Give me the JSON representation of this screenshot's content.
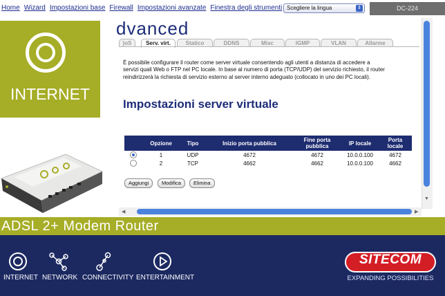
{
  "nav": {
    "items": [
      "Home",
      "Wizard",
      "Impostazioni base",
      "Firewall",
      "Impostazioni avanzate",
      "Finestra degli strumenti"
    ],
    "language_select": "Scegliere la lingua",
    "model": "DC-224"
  },
  "left_panel": {
    "big_label": "INTERNET"
  },
  "page": {
    "title": "dvanced",
    "tabs": [
      "QoS",
      "Serv. virt.",
      "Statico",
      "DDNS",
      "Misc",
      "IGMP",
      "VLAN",
      "Allarme"
    ],
    "tab_labels_visible": [
      ")oS",
      "Serv. virt.",
      "Statico",
      "DDNS",
      "Misc",
      "IGMP",
      "VLAN",
      "Allarme"
    ],
    "active_tab": "Serv. virt.",
    "description": "È possibile configurare il router come server virtuale consentendo agli utenti a distanza di accedere a servizi quali Web o FTP nel PC locale. In base al numero di porta (TCP/UDP) del servizio richiesto, il router reindirizzerà la richiesta di servizio esterno al server interno adeguato (collocato in uno dei PC locali).",
    "section_title": "Impostazioni server virtuale",
    "table": {
      "headers": [
        "",
        "Opzione",
        "Tipo",
        "Inizio porta pubblica",
        "Fine porta pubblica",
        "IP locale",
        "Porta locale"
      ],
      "rows": [
        {
          "selected": true,
          "opzione": "1",
          "tipo": "UDP",
          "inizio": "4672",
          "fine": "4672",
          "ip": "10.0.0.100",
          "porta": "4672"
        },
        {
          "selected": false,
          "opzione": "2",
          "tipo": "TCP",
          "inizio": "4662",
          "fine": "4662",
          "ip": "10.0.0.100",
          "porta": "4662"
        }
      ]
    },
    "buttons": [
      "Aggiungi",
      "Modifica",
      "Elimina"
    ]
  },
  "product_band": "ADSL 2+ Modem Router",
  "bottom": {
    "categories": [
      "INTERNET",
      "NETWORK",
      "CONNECTIVITY",
      "ENTERTAINMENT"
    ],
    "icons": [
      "internet-icon",
      "network-icon",
      "connectivity-icon",
      "entertainment-icon"
    ],
    "brand": "SITECOM",
    "tagline": "EXPANDING POSSIBILITIES"
  },
  "colors": {
    "navy": "#1c2961",
    "green": "#a6ad26",
    "brand_red": "#d41e26",
    "scroll_blue": "#4a83dd"
  }
}
